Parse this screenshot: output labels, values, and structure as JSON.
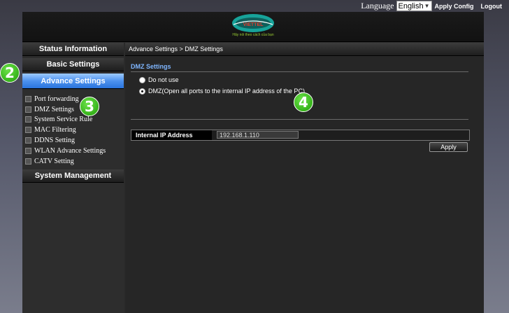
{
  "topbar": {
    "language_label": "Language",
    "language_value": "English",
    "apply_config": "Apply Config",
    "logout": "Logout"
  },
  "header": {
    "logo_text": "VIETTEL",
    "slogan": "Hãy nói theo cách của bạn"
  },
  "sidebar": {
    "status_information": "Status Information",
    "basic_settings": "Basic Settings",
    "advance_settings": "Advance Settings",
    "submenu": [
      "Port forwarding",
      "DMZ Settings",
      "System Service Rule",
      "MAC Filtering",
      "DDNS Setting",
      "WLAN Advance Settings",
      "CATV Setting"
    ],
    "system_management": "System Management"
  },
  "main": {
    "breadcrumb": "Advance Settings > DMZ Settings",
    "section_title": "DMZ Settings",
    "option_do_not_use": "Do not use",
    "option_dmz": "DMZ(Open all ports to the internal IP address of the PC)",
    "selected_option": "dmz",
    "ip_label": "Internal IP Address",
    "ip_value": "192.168.1.110",
    "apply": "Apply"
  },
  "steps": [
    "2",
    "3",
    "4"
  ],
  "colors": {
    "active_menu": "#4d92ee",
    "section_title": "#7fb6ff",
    "step_badge": "#36b31a"
  }
}
